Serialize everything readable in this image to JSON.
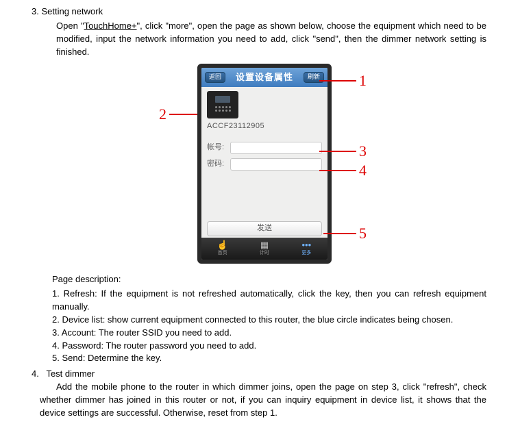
{
  "doc": {
    "section3_num": "3.",
    "section3_title": "Setting network",
    "intro_pre": "Open \"",
    "app_name": "TouchHome+",
    "intro_post": "\", click \"more\", open the page as shown below, choose the equipment which need to be modified, input the network information you need to add, click \"send\", then the dimmer network setting is finished.",
    "desc_title": "Page description:",
    "desc_items": [
      "1. Refresh: If the equipment is not refreshed automatically, click the key, then you can refresh equipment manually.",
      "2. Device list: show current equipment connected to this router, the blue circle indicates being chosen.",
      "3. Account: The router SSID you need to add.",
      "4. Password: The router password you need to add.",
      "5. Send: Determine the key."
    ],
    "section4_num": "4.",
    "section4_title": "Test dimmer",
    "section4_para": "Add the mobile phone to the router in which dimmer joins, open the page on step 3, click \"refresh\", check whether dimmer has joined in this router or not, if you can inquiry equipment in device list, it shows that the device settings are successful. Otherwise, reset from step 1."
  },
  "phone": {
    "back_label": "返回",
    "refresh_label": "刷新",
    "title": "设置设备属性",
    "device_id": "ACCF23112905",
    "account_label": "帐号:",
    "password_label": "密码:",
    "send_label": "发送",
    "tabs": {
      "t1": "首页",
      "t2": "计时",
      "t3": "更多"
    }
  },
  "callouts": {
    "c1": "1",
    "c2": "2",
    "c3": "3",
    "c4": "4",
    "c5": "5"
  }
}
